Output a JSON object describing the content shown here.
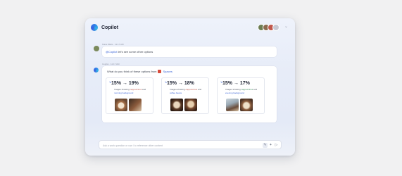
{
  "app": {
    "title": "Copilot"
  },
  "header": {
    "avatars": [
      "avatar-1",
      "avatar-2",
      "avatar-3",
      "avatar-4"
    ],
    "menu_icon": "chevron-down-icon"
  },
  "user_message": {
    "meta": "Kiara Watts · 11:17 AM",
    "mention": "@Copilot",
    "text": " let's see some other options"
  },
  "copilot_message": {
    "meta": "Copilot · 11:17 AM",
    "question_prefix": "What do you think of these options from",
    "question_source": "Spaces",
    "options": [
      {
        "rate": "15% → 19%",
        "desc_prefix": "Images showing ",
        "desc_hl1": "cappuccinos",
        "desc_mid": " and ",
        "desc_hl2": "morning background"
      },
      {
        "rate": "15% → 18%",
        "desc_prefix": "Images showing ",
        "desc_hl1": "cappuccinos",
        "desc_mid": " and ",
        "desc_hl2": "coffee beans"
      },
      {
        "rate": "15% → 17%",
        "desc_prefix": "Images showing ",
        "desc_hl1": "cappuccinos",
        "desc_mid": " and ",
        "desc_hl2": "evening background"
      }
    ]
  },
  "input": {
    "placeholder": "Ask a work question or use / to reference other content",
    "icons": [
      "attach-icon",
      "sparkle-icon",
      "send-icon"
    ]
  },
  "colors": {
    "accent": "#3a63d6",
    "background": "#f1f1f2"
  }
}
